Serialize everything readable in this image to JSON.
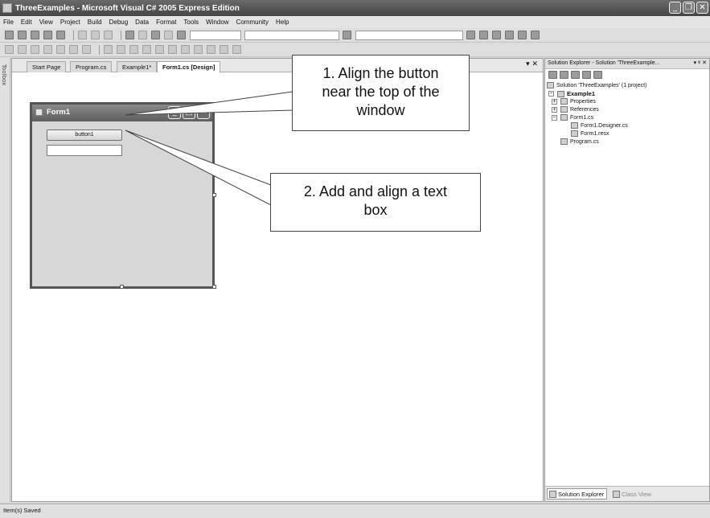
{
  "window": {
    "title": "ThreeExamples - Microsoft Visual C# 2005 Express Edition",
    "controls": [
      "_",
      "❐",
      "✕"
    ]
  },
  "menu": [
    "File",
    "Edit",
    "View",
    "Project",
    "Build",
    "Debug",
    "Data",
    "Format",
    "Tools",
    "Window",
    "Community",
    "Help"
  ],
  "editor": {
    "tabs": [
      "Start Page",
      "Program.cs",
      "Example1*",
      "Form1.cs [Design]"
    ],
    "active_tab_index": 3,
    "tab_controls": "▾ ✕"
  },
  "form": {
    "title": "Form1",
    "controls": [
      "_",
      "□",
      "✕"
    ],
    "button_text": "button1",
    "textbox_value": ""
  },
  "callouts": {
    "one": [
      "1. Align the button",
      "near the top of the",
      "window"
    ],
    "two": [
      "2. Add and align a text",
      "box"
    ]
  },
  "solution_explorer": {
    "header": "Solution Explorer - Solution 'ThreeExample...",
    "header_controls": "▾ ᵠ ✕",
    "tree": {
      "solution": "Solution 'ThreeExamples' (1 project)",
      "project": "Example1",
      "properties": "Properties",
      "references": "References",
      "form_cs": "Form1.cs",
      "designer": "Form1.Designer.cs",
      "resx": "Form1.resx",
      "program": "Program.cs"
    },
    "bottom_tabs": [
      "Solution Explorer",
      "Class View"
    ]
  },
  "side_tab": "Toolbox",
  "status": "Item(s) Saved"
}
